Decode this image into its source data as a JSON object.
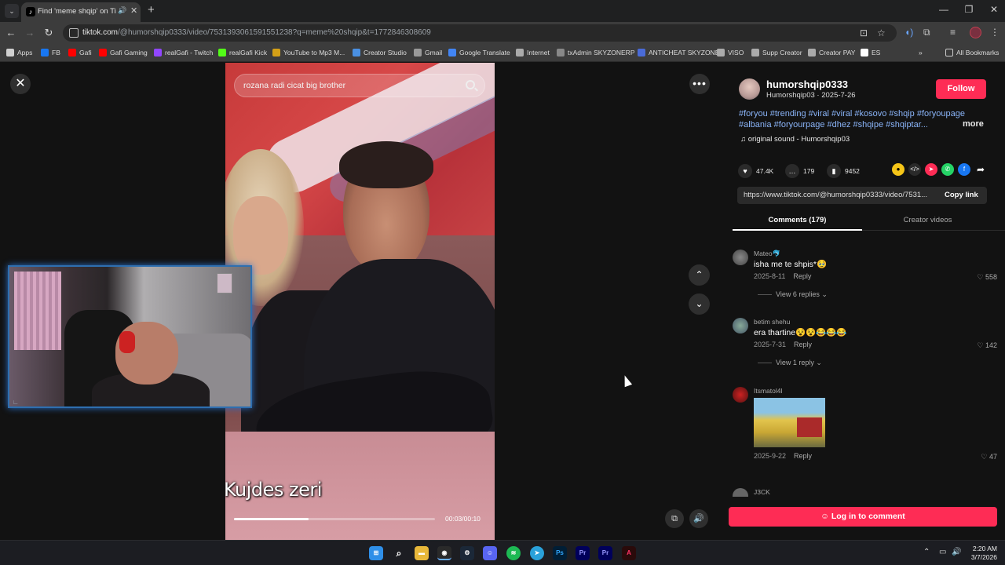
{
  "browser": {
    "tab": {
      "title": "Find 'meme shqip' on TikTo",
      "favicon": "tiktok-icon"
    },
    "url": {
      "host": "tiktok.com",
      "path": "/@humorshqip0333/video/7531393061591551238?q=meme%20shqip&t=1772846308609"
    },
    "bookmarks": [
      {
        "label": "Apps",
        "icon": "apps-grid-icon",
        "color": "#d0d0d0"
      },
      {
        "label": "FB",
        "icon": "facebook-icon",
        "color": "#1877f2"
      },
      {
        "label": "Gafi",
        "icon": "youtube-icon",
        "color": "#ff0000"
      },
      {
        "label": "Gafi Gaming",
        "icon": "youtube-icon",
        "color": "#ff0000"
      },
      {
        "label": "realGafi - Twitch",
        "icon": "twitch-icon",
        "color": "#9146ff"
      },
      {
        "label": "realGafi Kick",
        "icon": "kick-icon",
        "color": "#53fc18"
      },
      {
        "label": "YouTube to Mp3 M...",
        "icon": "chevron-icon",
        "color": "#d4a017"
      },
      {
        "label": "Creator Studio",
        "icon": "infinity-icon",
        "color": "#4a90e2"
      },
      {
        "label": "Gmail",
        "icon": "globe-icon",
        "color": "#999999"
      },
      {
        "label": "Google Translate",
        "icon": "translate-icon",
        "color": "#4285f4"
      },
      {
        "label": "Internet",
        "icon": "globe-icon",
        "color": "#aaaaaa"
      },
      {
        "label": "txAdmin SKYZONERP",
        "icon": "server-icon",
        "color": "#888888"
      },
      {
        "label": "ANTICHEAT SKYZONE",
        "icon": "shield-icon",
        "color": "#4a6bd8"
      },
      {
        "label": "VISO",
        "icon": "globe-icon",
        "color": "#aaaaaa"
      },
      {
        "label": "Supp Creator",
        "icon": "link-icon",
        "color": "#aaaaaa"
      },
      {
        "label": "Creator PAY",
        "icon": "globe-icon",
        "color": "#aaaaaa"
      },
      {
        "label": "ES",
        "icon": "es-icon",
        "color": "#ffffff"
      }
    ],
    "all_bookmarks": "All Bookmarks"
  },
  "video": {
    "search_text": "rozana radi cicat big brother",
    "caption": "Kujdes zeri",
    "time": "00:03/00:10",
    "progress": 0.37
  },
  "panel": {
    "author": "humorshqip0333",
    "author_meta": "Humorshqip03 · 2025-7-26",
    "follow": "Follow",
    "tags": "#foryou #trending #viral #viral #kosovo #shqip #foryoupage #albania #foryourpage #dhez #shqipe #shqiptar...",
    "more": "more",
    "sound": "original sound - Humorshqip03",
    "likes": "47.4K",
    "comments_count": "179",
    "saves": "9452",
    "link": "https://www.tiktok.com/@humorshqip0333/video/7531...",
    "copy_link": "Copy link",
    "tab_comments": "Comments (179)",
    "tab_creator": "Creator videos",
    "login": "Log in to comment"
  },
  "comments": [
    {
      "user": "Mateo🐬",
      "text": "isha me te shpis*🥹",
      "date": "2025-8-11",
      "reply": "Reply",
      "likes": "558",
      "replies": "View 6 replies"
    },
    {
      "user": "betim shehu",
      "text": "era thartine😵😵😂😂😂",
      "date": "2025-7-31",
      "reply": "Reply",
      "likes": "142",
      "replies": "View 1 reply"
    },
    {
      "user": "Itsmatol4l",
      "text": "",
      "date": "2025-9-22",
      "reply": "Reply",
      "likes": "47",
      "replies": ""
    },
    {
      "user": "J3CK"
    }
  ],
  "taskbar": {
    "time": "2:20 AM",
    "date": "3/7/2026"
  }
}
